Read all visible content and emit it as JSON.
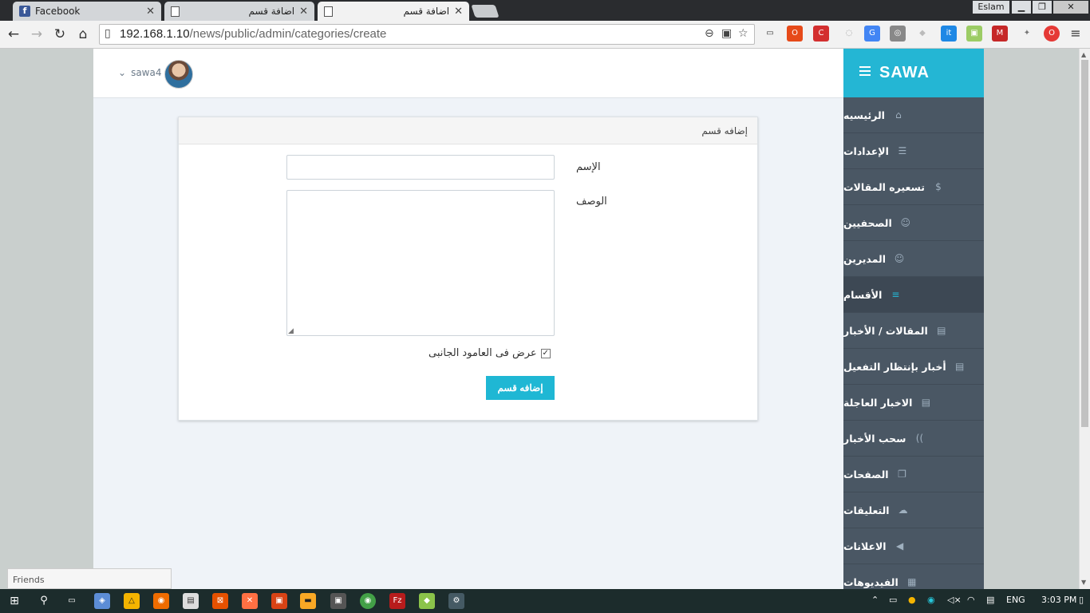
{
  "browser": {
    "tabs": [
      {
        "title": "Facebook",
        "icon": "facebook-icon",
        "active": false
      },
      {
        "title": "اضافة قسم",
        "icon": "document-icon",
        "active": false
      },
      {
        "title": "اضافة قسم",
        "icon": "document-icon",
        "active": true
      }
    ],
    "profile_name": "Eslam",
    "url_host": "192.168.1.10",
    "url_path": "/news/public/admin/categories/create"
  },
  "header": {
    "username": "sawa4",
    "logo_text": "SAWA"
  },
  "sidebar": {
    "items": [
      {
        "label": "الرئيسيه",
        "icon": "home-icon",
        "glyph": "⌂"
      },
      {
        "label": "الإعدادات",
        "icon": "settings-list-icon",
        "glyph": "☰"
      },
      {
        "label": "تسعيره المقالات",
        "icon": "dollar-icon",
        "glyph": "$"
      },
      {
        "label": "الصحفيين",
        "icon": "user-icon",
        "glyph": "☺"
      },
      {
        "label": "المديرين",
        "icon": "users-icon",
        "glyph": "☺"
      },
      {
        "label": "الأقسام",
        "icon": "list-icon",
        "glyph": "≡",
        "active": true
      },
      {
        "label": "المقالات / الأخبار",
        "icon": "newspaper-icon",
        "glyph": "▤"
      },
      {
        "label": "أخبار بإنتظار التفعيل",
        "icon": "newspaper-icon",
        "glyph": "▤"
      },
      {
        "label": "الاخبار العاجلة",
        "icon": "newspaper-icon",
        "glyph": "▤"
      },
      {
        "label": "سحب الأخبار",
        "icon": "rss-icon",
        "glyph": "))"
      },
      {
        "label": "الصفحات",
        "icon": "pages-icon",
        "glyph": "❐"
      },
      {
        "label": "التعليقات",
        "icon": "comments-icon",
        "glyph": "☁"
      },
      {
        "label": "الاعلانات",
        "icon": "bullhorn-icon",
        "glyph": "◀"
      },
      {
        "label": "الفيديوهات",
        "icon": "film-icon",
        "glyph": "▦"
      }
    ]
  },
  "form": {
    "title": "إضافه قسم",
    "name_label": "الإسم",
    "name_value": "",
    "description_label": "الوصف",
    "description_value": "",
    "sidebar_checkbox_label": "عرض فى العامود الجانبى",
    "sidebar_checkbox_checked": true,
    "submit_label": "إضافه قسم"
  },
  "chat": {
    "friends_label": "Friends"
  },
  "taskbar": {
    "language": "ENG",
    "time": "3:03 PM"
  }
}
